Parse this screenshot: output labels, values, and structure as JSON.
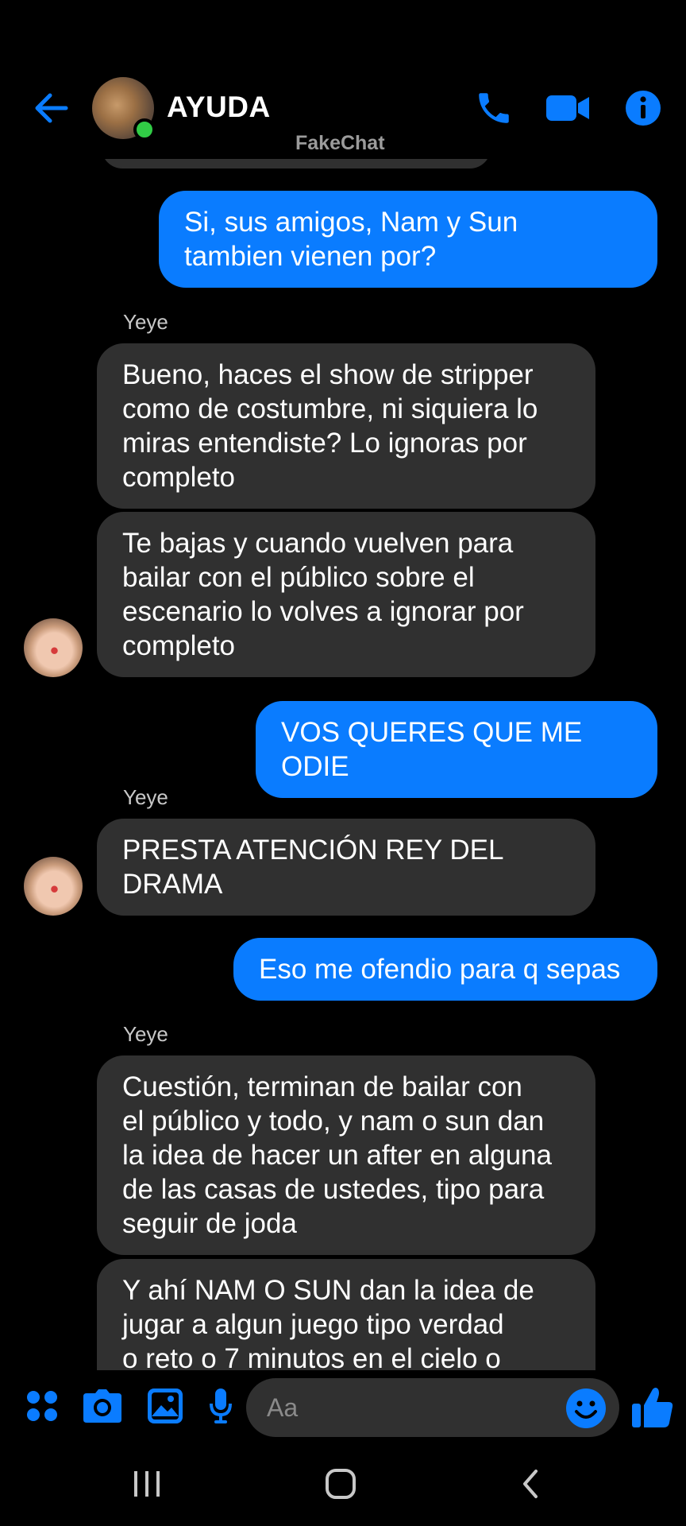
{
  "header": {
    "contact_name": "AYUDA",
    "watermark": "FakeChat",
    "icons": [
      "back-arrow-icon",
      "phone-icon",
      "video-camera-icon",
      "info-icon"
    ],
    "accent_color": "#0a7cff",
    "online_color": "#31cc46"
  },
  "messages": [
    {
      "dir": "out",
      "text": "Si, sus amigos, Nam y Sun\ntambien vienen por?"
    },
    {
      "dir": "sender",
      "text": "Yeye"
    },
    {
      "dir": "in",
      "text": "Bueno, haces el show de stripper\ncomo de costumbre, ni siquiera lo\nmiras entendiste? Lo ignoras por\ncompleto"
    },
    {
      "dir": "in",
      "text": "Te bajas y cuando vuelven para\nbailar con el público sobre el\nescenario lo volves a ignorar por\ncompleto"
    },
    {
      "dir": "out",
      "text": "VOS QUERES QUE ME ODIE"
    },
    {
      "dir": "sender",
      "text": "Yeye"
    },
    {
      "dir": "in",
      "text": "PRESTA ATENCIÓN REY DEL\nDRAMA"
    },
    {
      "dir": "out",
      "text": "Eso me ofendio para q sepas"
    },
    {
      "dir": "sender",
      "text": "Yeye"
    },
    {
      "dir": "in",
      "text": "Cuestión, terminan de bailar con\nel público y todo, y nam o sun dan\nla idea de hacer un after en alguna\nde las casas de ustedes, tipo para\nseguir de joda"
    },
    {
      "dir": "in",
      "text": "Y ahí NAM O SUN dan la idea de\njugar a algun juego tipo verdad\no reto o 7 minutos en el cielo o"
    }
  ],
  "composer": {
    "placeholder": "Aa",
    "icons": [
      "apps-icon",
      "camera-icon",
      "gallery-icon",
      "mic-icon",
      "emoji-icon",
      "thumbs-up-icon"
    ]
  },
  "navbar": {
    "icons": [
      "recent-apps-icon",
      "home-icon",
      "back-icon"
    ]
  }
}
